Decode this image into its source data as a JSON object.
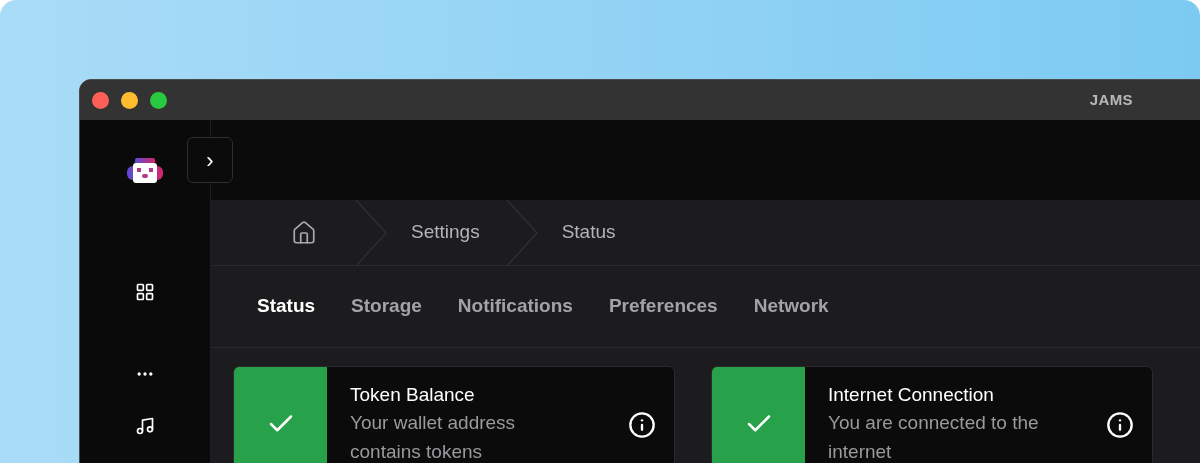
{
  "window": {
    "title": "JAMS"
  },
  "sidebar": {
    "items": [
      {
        "kind": "grid"
      },
      {
        "kind": "more"
      },
      {
        "kind": "music"
      }
    ]
  },
  "expand_button": {
    "label": "›"
  },
  "breadcrumb": [
    "Settings",
    "Status"
  ],
  "tabs": [
    {
      "label": "Status",
      "selected": true
    },
    {
      "label": "Storage",
      "selected": false
    },
    {
      "label": "Notifications",
      "selected": false
    },
    {
      "label": "Preferences",
      "selected": false
    },
    {
      "label": "Network",
      "selected": false
    }
  ],
  "cards": [
    {
      "title": "Token Balance",
      "description": "Your wallet address contains tokens",
      "ok": true
    },
    {
      "title": "Internet Connection",
      "description": "You are connected to the internet",
      "ok": true
    }
  ]
}
